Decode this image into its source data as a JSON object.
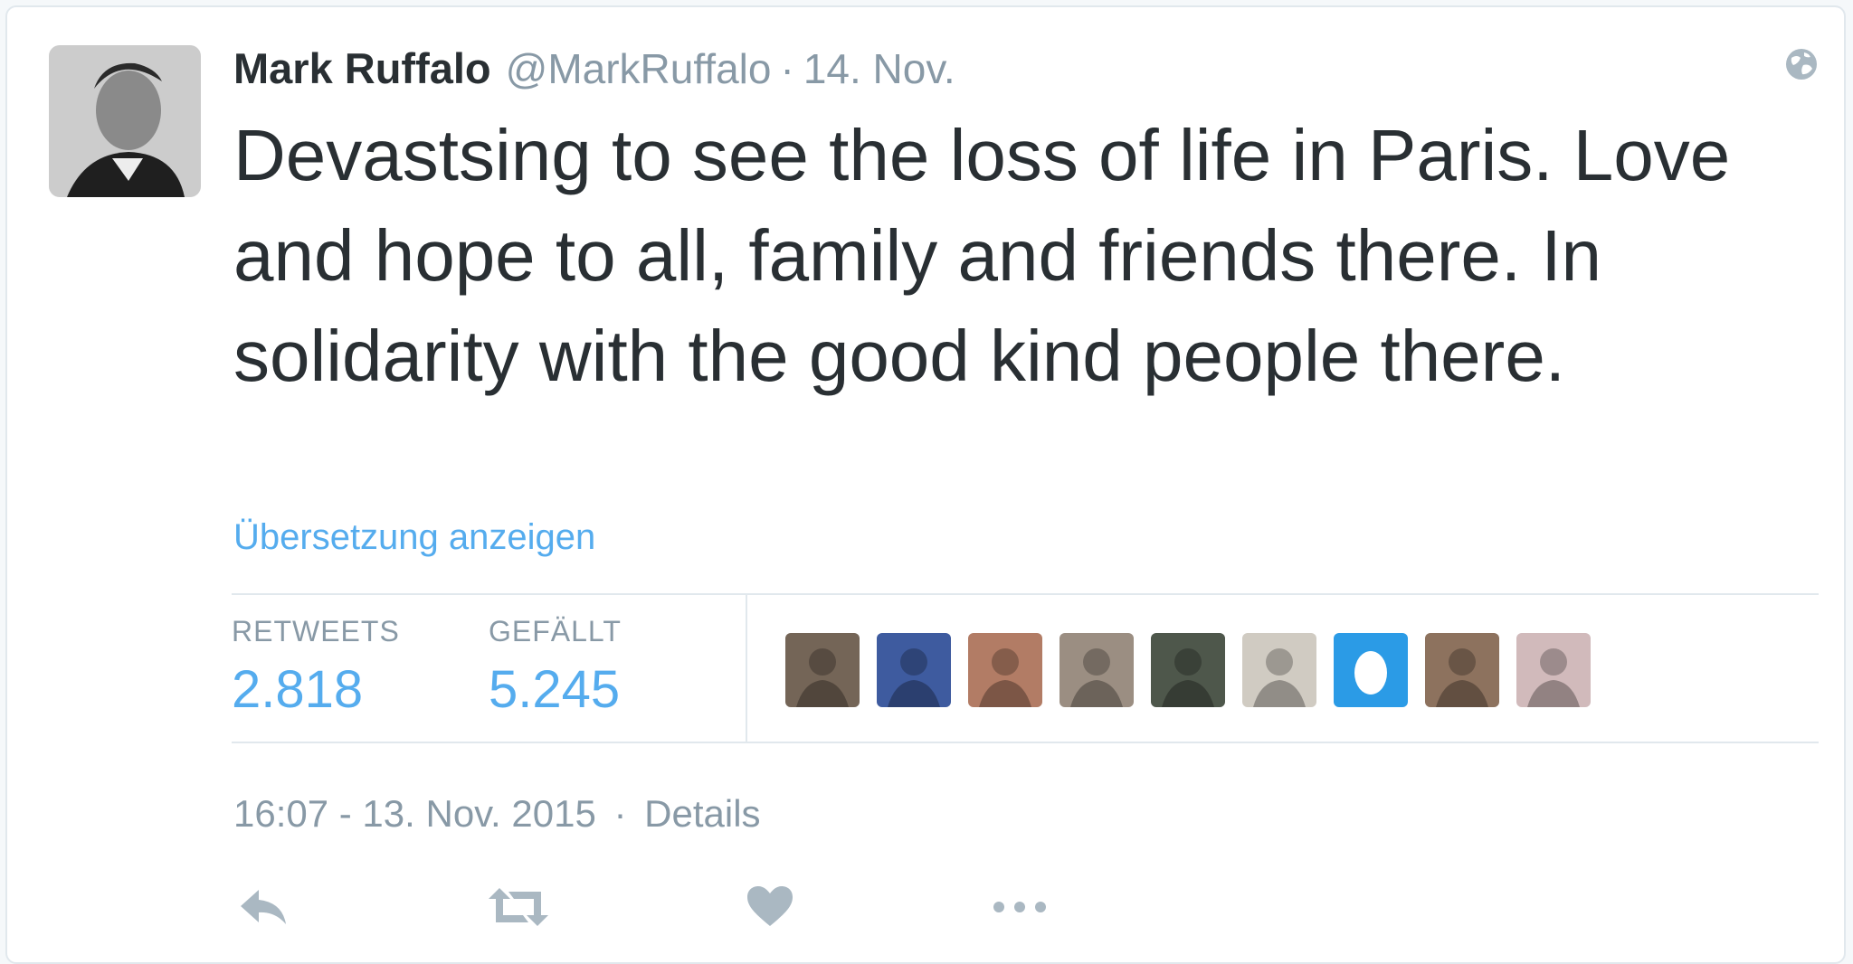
{
  "tweet": {
    "author_name": "Mark Ruffalo",
    "author_handle": "@MarkRuffalo",
    "separator": "·",
    "date": "14. Nov.",
    "text": "Devastsing to see the loss of life in Paris. Love and hope to all, family and friends there. In solidarity with the good kind people there.",
    "translate_link": "Übersetzung anzeigen"
  },
  "stats": {
    "retweets_label": "RETWEETS",
    "retweets_value": "2.818",
    "likes_label": "GEFÄLLT",
    "likes_value": "5.245"
  },
  "liked_by": [
    {
      "icon": "user-avatar",
      "color": "#5c4b3a"
    },
    {
      "icon": "user-avatar",
      "color": "#1d3f8f"
    },
    {
      "icon": "user-avatar",
      "color": "#a5654a"
    },
    {
      "icon": "user-avatar",
      "color": "#8a7b6d"
    },
    {
      "icon": "user-avatar",
      "color": "#2f3a2c"
    },
    {
      "icon": "user-avatar",
      "color": "#c8c2b8"
    },
    {
      "icon": "egg-avatar",
      "color": "#2b9be6"
    },
    {
      "icon": "user-avatar",
      "color": "#7a5a42"
    },
    {
      "icon": "user-avatar",
      "color": "#c9aeb0"
    }
  ],
  "footer": {
    "timestamp": "16:07 - 13. Nov. 2015",
    "separator": "·",
    "details_link": "Details"
  },
  "actions": [
    {
      "name": "reply-icon"
    },
    {
      "name": "retweet-icon"
    },
    {
      "name": "like-icon"
    },
    {
      "name": "more-icon"
    }
  ],
  "colors": {
    "link": "#55acee",
    "muted": "#8899a6",
    "text": "#292f33",
    "border": "#e1e8ed",
    "action_icon": "#aab8c2"
  }
}
